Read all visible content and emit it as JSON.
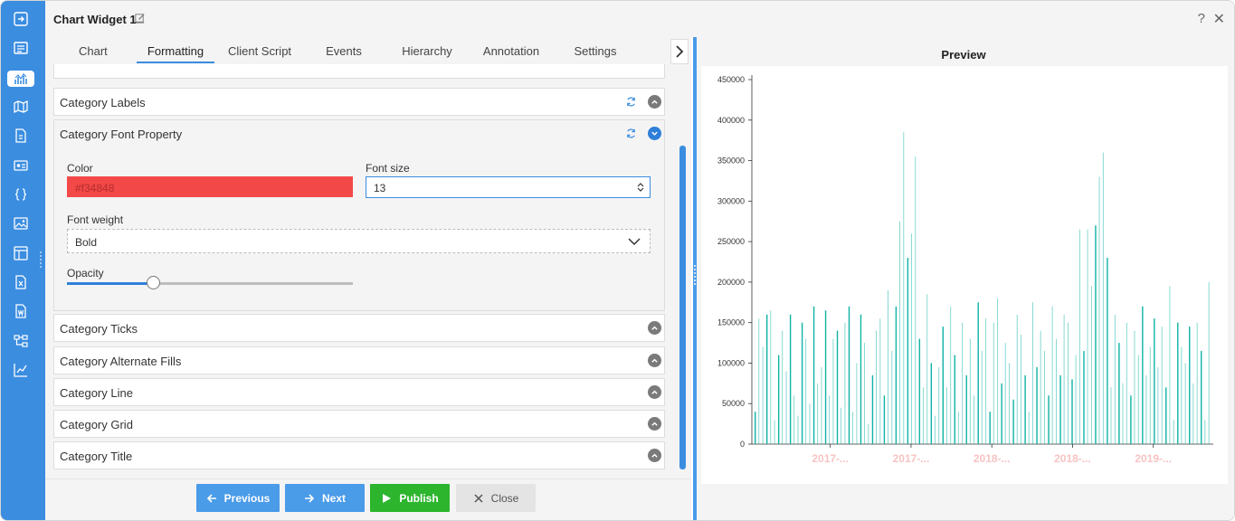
{
  "window": {
    "title": "Chart Widget 1",
    "help": "?",
    "close": "✕"
  },
  "tabs": [
    {
      "label": "Chart",
      "active": false
    },
    {
      "label": "Formatting",
      "active": true
    },
    {
      "label": "Client Script",
      "active": false
    },
    {
      "label": "Events",
      "active": false
    },
    {
      "label": "Hierarchy",
      "active": false
    },
    {
      "label": "Annotation",
      "active": false
    },
    {
      "label": "Settings",
      "active": false
    }
  ],
  "panels": {
    "category_labels": "Category Labels",
    "category_font_property": "Category Font Property",
    "category_ticks": "Category Ticks",
    "category_alternate_fills": "Category Alternate Fills",
    "category_line": "Category Line",
    "category_grid": "Category Grid",
    "category_title": "Category Title"
  },
  "font_property": {
    "color_label": "Color",
    "color_value": "#f34848",
    "font_size_label": "Font size",
    "font_size_value": "13",
    "font_weight_label": "Font weight",
    "font_weight_value": "Bold",
    "opacity_label": "Opacity",
    "opacity_value": 0.3
  },
  "footer": {
    "previous": "Previous",
    "next": "Next",
    "publish": "Publish",
    "close": "Close"
  },
  "preview": {
    "title": "Preview"
  },
  "colors": {
    "accent": "#3b8de0",
    "publish": "#2db52d",
    "category_label_color": "#f34848",
    "bar_color": "#0fb3a6"
  },
  "chart_data": {
    "type": "bar",
    "ylim": [
      0,
      450000
    ],
    "yticks": [
      0,
      50000,
      100000,
      150000,
      200000,
      250000,
      300000,
      350000,
      400000,
      450000
    ],
    "ytick_labels": [
      "0",
      "50000",
      "100000",
      "150000",
      "200000",
      "250000",
      "300000",
      "350000",
      "400000",
      "450000"
    ],
    "xtick_labels": [
      "2017-...",
      "2017-...",
      "2018-...",
      "2018-...",
      "2019-..."
    ],
    "values": [
      40000,
      155000,
      120000,
      160000,
      165000,
      30000,
      110000,
      140000,
      90000,
      160000,
      60000,
      35000,
      150000,
      130000,
      50000,
      170000,
      75000,
      95000,
      165000,
      60000,
      130000,
      140000,
      45000,
      150000,
      170000,
      40000,
      100000,
      160000,
      125000,
      25000,
      85000,
      140000,
      155000,
      60000,
      190000,
      115000,
      170000,
      275000,
      385000,
      230000,
      260000,
      355000,
      130000,
      70000,
      185000,
      100000,
      35000,
      95000,
      145000,
      70000,
      170000,
      110000,
      40000,
      150000,
      85000,
      130000,
      60000,
      175000,
      115000,
      155000,
      40000,
      150000,
      180000,
      75000,
      125000,
      100000,
      55000,
      160000,
      135000,
      85000,
      40000,
      175000,
      95000,
      140000,
      115000,
      60000,
      170000,
      130000,
      85000,
      160000,
      150000,
      80000,
      110000,
      265000,
      115000,
      265000,
      195000,
      270000,
      330000,
      360000,
      230000,
      70000,
      160000,
      125000,
      75000,
      150000,
      60000,
      140000,
      110000,
      170000,
      85000,
      120000,
      155000,
      95000,
      145000,
      70000,
      195000,
      30000,
      150000,
      120000,
      100000,
      145000,
      75000,
      150000,
      115000,
      30000,
      200000
    ]
  }
}
